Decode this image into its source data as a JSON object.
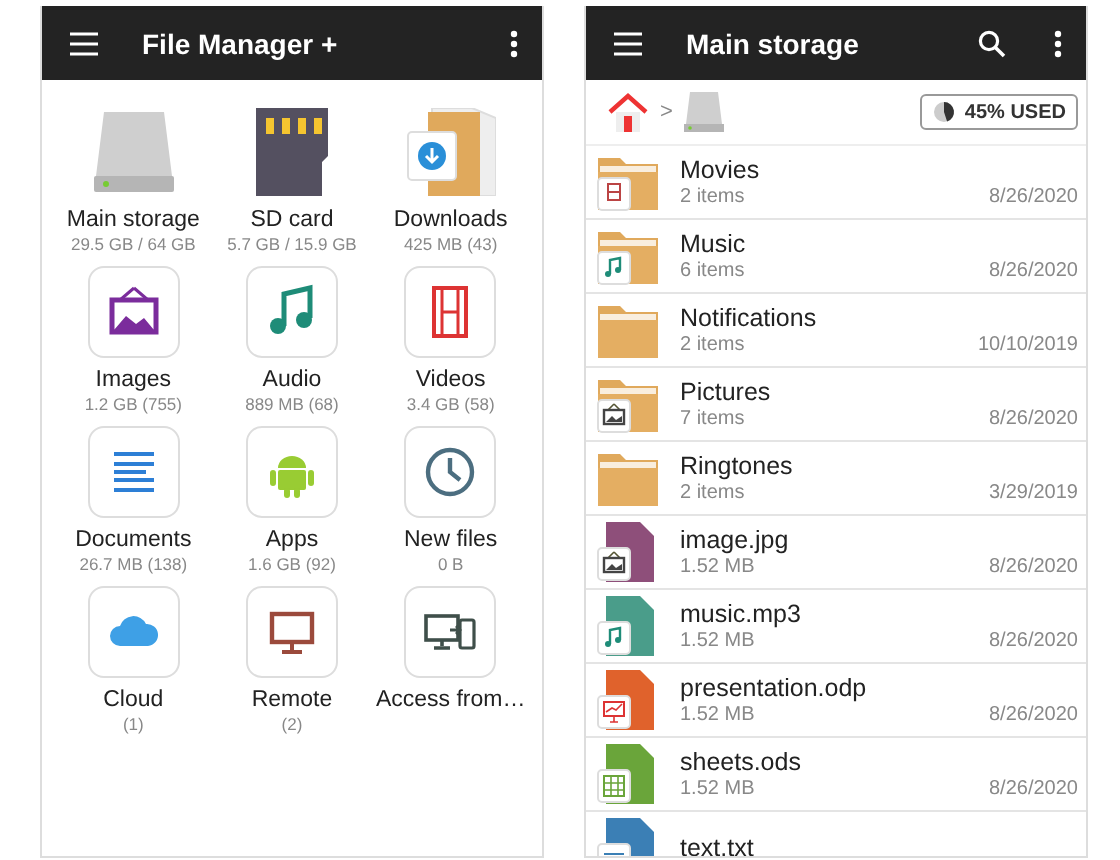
{
  "home_screen": {
    "title": "File Manager +",
    "tiles": [
      {
        "kind": "drive",
        "label": "Main storage",
        "detail": "29.5 GB / 64 GB"
      },
      {
        "kind": "sdcard",
        "label": "SD card",
        "detail": "5.7 GB / 15.9 GB"
      },
      {
        "kind": "downloads",
        "label": "Downloads",
        "detail": "425 MB (43)"
      },
      {
        "kind": "images",
        "label": "Images",
        "detail": "1.2 GB (755)"
      },
      {
        "kind": "audio",
        "label": "Audio",
        "detail": "889 MB (68)"
      },
      {
        "kind": "videos",
        "label": "Videos",
        "detail": "3.4 GB (58)"
      },
      {
        "kind": "documents",
        "label": "Documents",
        "detail": "26.7 MB (138)"
      },
      {
        "kind": "apps",
        "label": "Apps",
        "detail": "1.6 GB (92)"
      },
      {
        "kind": "recent",
        "label": "New files",
        "detail": "0 B"
      },
      {
        "kind": "cloud",
        "label": "Cloud",
        "detail": "(1)"
      },
      {
        "kind": "remote",
        "label": "Remote",
        "detail": "(2)"
      },
      {
        "kind": "devices",
        "label": "Access from…"
      }
    ]
  },
  "storage_screen": {
    "title": "Main storage",
    "breadcrumb": {
      "separator": ">"
    },
    "storage_usage": {
      "label": "45% USED",
      "level": 0.45
    },
    "files": [
      {
        "kind": "folder",
        "badge": {
          "kind": "film"
        },
        "name": "Movies",
        "detail": "2 items",
        "date": "8/26/2020"
      },
      {
        "kind": "folder",
        "badge": {
          "kind": "music"
        },
        "name": "Music",
        "detail": "6 items",
        "date": "8/26/2020"
      },
      {
        "kind": "folder",
        "name": "Notifications",
        "detail": "2 items",
        "date": "10/10/2019"
      },
      {
        "kind": "folder",
        "badge": {
          "kind": "picture"
        },
        "name": "Pictures",
        "detail": "7 items",
        "date": "8/26/2020"
      },
      {
        "kind": "folder",
        "name": "Ringtones",
        "detail": "2 items",
        "date": "3/29/2019"
      },
      {
        "kind": "file",
        "badge": {
          "kind": "picture"
        },
        "color": "#8e4f7a",
        "name": "image.jpg",
        "detail": "1.52 MB",
        "date": "8/26/2020"
      },
      {
        "kind": "file",
        "badge": {
          "kind": "music"
        },
        "color": "#4a9d8a",
        "name": "music.mp3",
        "detail": "1.52 MB",
        "date": "8/26/2020"
      },
      {
        "kind": "file",
        "badge": {
          "kind": "slides"
        },
        "color": "#e0622c",
        "name": "presentation.odp",
        "detail": "1.52 MB",
        "date": "8/26/2020"
      },
      {
        "kind": "file",
        "badge": {
          "kind": "grid"
        },
        "color": "#6aa53a",
        "name": "sheets.ods",
        "detail": "1.52 MB",
        "date": "8/26/2020"
      },
      {
        "kind": "file",
        "badge": {
          "kind": "lines"
        },
        "color": "#3b7fb5",
        "name": "text.txt"
      }
    ]
  }
}
